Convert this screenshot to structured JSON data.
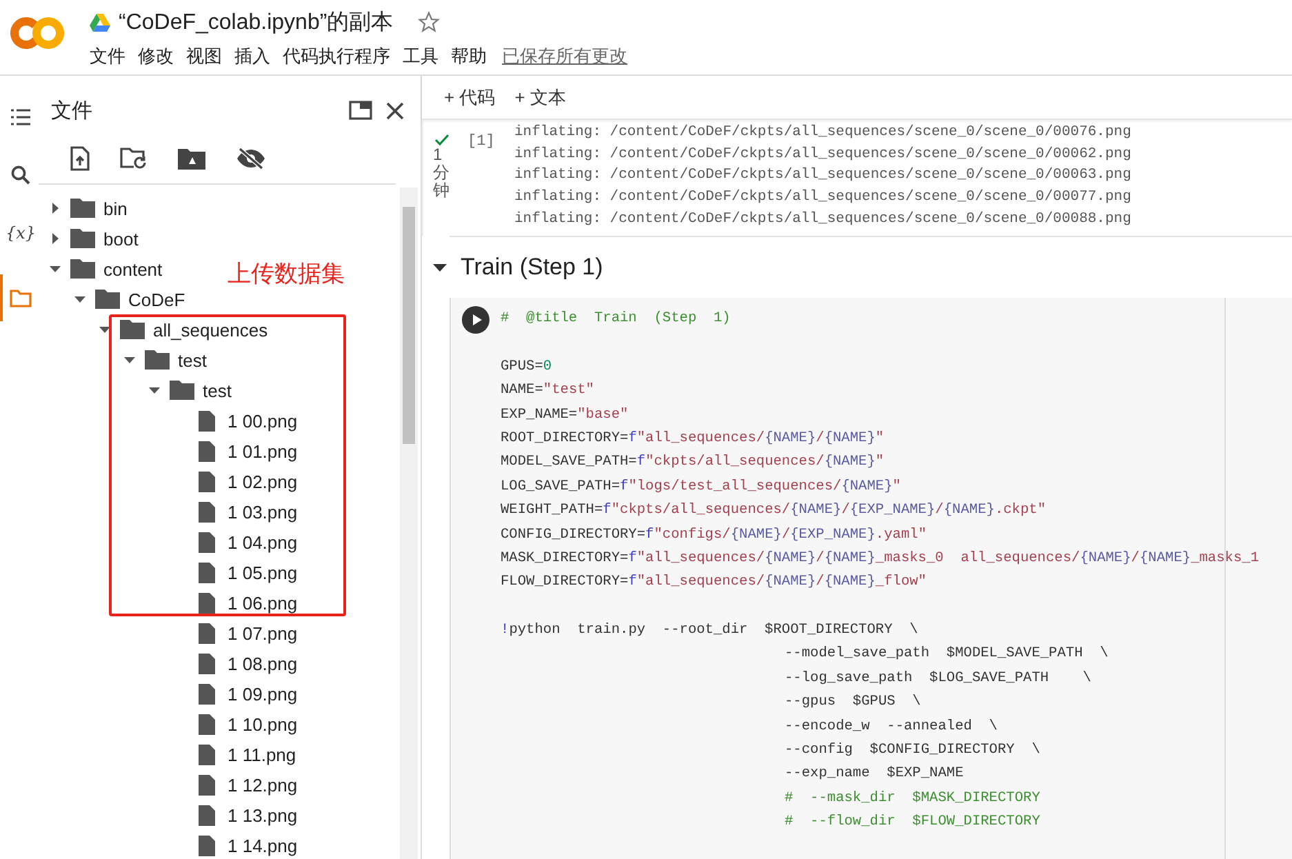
{
  "app": {
    "title": "“CoDeF_colab.ipynb”的副本",
    "starred": false,
    "menu": [
      "文件",
      "修改",
      "视图",
      "插入",
      "代码执行程序",
      "工具",
      "帮助"
    ],
    "save_status": "已保存所有更改"
  },
  "rail": [
    {
      "kind": "menu",
      "selected": false
    },
    {
      "kind": "search",
      "selected": false
    },
    {
      "kind": "variables",
      "glyph": "{x}",
      "selected": false
    },
    {
      "kind": "folder",
      "selected": true
    }
  ],
  "sidebar": {
    "title": "文件",
    "annotation": "上传数据集",
    "tree": [
      {
        "name": "bin",
        "kind": "folder",
        "expanded": false
      },
      {
        "name": "boot",
        "kind": "folder",
        "expanded": false
      },
      {
        "name": "content",
        "kind": "folder",
        "expanded": true,
        "children": [
          {
            "name": "CoDeF",
            "kind": "folder",
            "expanded": true,
            "children": [
              {
                "name": "all_sequences",
                "kind": "folder",
                "expanded": true,
                "children": [
                  {
                    "name": "test",
                    "kind": "folder",
                    "expanded": true,
                    "children": [
                      {
                        "name": "test",
                        "kind": "folder",
                        "expanded": true,
                        "children": [
                          {
                            "name": "1 00.png",
                            "kind": "file"
                          },
                          {
                            "name": "1 01.png",
                            "kind": "file"
                          },
                          {
                            "name": "1 02.png",
                            "kind": "file"
                          },
                          {
                            "name": "1 03.png",
                            "kind": "file"
                          },
                          {
                            "name": "1 04.png",
                            "kind": "file"
                          },
                          {
                            "name": "1 05.png",
                            "kind": "file"
                          },
                          {
                            "name": "1 06.png",
                            "kind": "file"
                          },
                          {
                            "name": "1 07.png",
                            "kind": "file"
                          },
                          {
                            "name": "1 08.png",
                            "kind": "file"
                          },
                          {
                            "name": "1 09.png",
                            "kind": "file"
                          },
                          {
                            "name": "1 10.png",
                            "kind": "file"
                          },
                          {
                            "name": "1 11.png",
                            "kind": "file"
                          },
                          {
                            "name": "1 12.png",
                            "kind": "file"
                          },
                          {
                            "name": "1 13.png",
                            "kind": "file"
                          },
                          {
                            "name": "1 14.png",
                            "kind": "file"
                          }
                        ]
                      }
                    ]
                  }
                ]
              }
            ]
          }
        ]
      }
    ]
  },
  "toolbar": [
    "+ 代码",
    "+ 文本"
  ],
  "output_cell": {
    "succeeded": true,
    "duration": "1分钟",
    "count": "[1]",
    "lines": [
      "inflating: /content/CoDeF/ckpts/all_sequences/scene_0/scene_0/00076.png",
      "inflating: /content/CoDeF/ckpts/all_sequences/scene_0/scene_0/00062.png",
      "inflating: /content/CoDeF/ckpts/all_sequences/scene_0/scene_0/00063.png",
      "inflating: /content/CoDeF/ckpts/all_sequences/scene_0/scene_0/00077.png",
      "inflating: /content/CoDeF/ckpts/all_sequences/scene_0/scene_0/00088.png"
    ]
  },
  "section": {
    "title": "Train (Step 1)",
    "expanded": true
  },
  "code_cell": {
    "lines": [
      {
        "tokens": [
          {
            "kind": "comment",
            "text": "#  @title  Train  (Step  1)"
          }
        ]
      },
      {
        "space_before": true,
        "tokens": [
          {
            "kind": "plain",
            "text": "GPUS="
          },
          {
            "kind": "number",
            "text": "0"
          }
        ]
      },
      {
        "tokens": [
          {
            "kind": "plain",
            "text": "NAME="
          },
          {
            "kind": "string",
            "text": "\"test\""
          }
        ]
      },
      {
        "tokens": [
          {
            "kind": "plain",
            "text": "EXP_NAME="
          },
          {
            "kind": "string",
            "text": "\"base\""
          }
        ]
      },
      {
        "tokens": [
          {
            "kind": "plain",
            "text": "ROOT_DIRECTORY="
          },
          {
            "kind": "keyword",
            "text": "f"
          },
          {
            "kind": "string",
            "text": "\"all_sequences/"
          },
          {
            "kind": "brace",
            "text": "{NAME}"
          },
          {
            "kind": "string",
            "text": "/"
          },
          {
            "kind": "brace",
            "text": "{NAME}"
          },
          {
            "kind": "string",
            "text": "\""
          }
        ]
      },
      {
        "tokens": [
          {
            "kind": "plain",
            "text": "MODEL_SAVE_PATH="
          },
          {
            "kind": "keyword",
            "text": "f"
          },
          {
            "kind": "string",
            "text": "\"ckpts/all_sequences/"
          },
          {
            "kind": "brace",
            "text": "{NAME}"
          },
          {
            "kind": "string",
            "text": "\""
          }
        ]
      },
      {
        "tokens": [
          {
            "kind": "plain",
            "text": "LOG_SAVE_PATH="
          },
          {
            "kind": "keyword",
            "text": "f"
          },
          {
            "kind": "string",
            "text": "\"logs/test_all_sequences/"
          },
          {
            "kind": "brace",
            "text": "{NAME}"
          },
          {
            "kind": "string",
            "text": "\""
          }
        ]
      },
      {
        "tokens": [
          {
            "kind": "plain",
            "text": "WEIGHT_PATH="
          },
          {
            "kind": "keyword",
            "text": "f"
          },
          {
            "kind": "string",
            "text": "\"ckpts/all_sequences/"
          },
          {
            "kind": "brace",
            "text": "{NAME}"
          },
          {
            "kind": "string",
            "text": "/"
          },
          {
            "kind": "brace",
            "text": "{EXP_NAME}"
          },
          {
            "kind": "string",
            "text": "/"
          },
          {
            "kind": "brace",
            "text": "{NAME}"
          },
          {
            "kind": "string",
            "text": ".ckpt\""
          }
        ]
      },
      {
        "tokens": [
          {
            "kind": "plain",
            "text": "CONFIG_DIRECTORY="
          },
          {
            "kind": "keyword",
            "text": "f"
          },
          {
            "kind": "string",
            "text": "\"configs/"
          },
          {
            "kind": "brace",
            "text": "{NAME}"
          },
          {
            "kind": "string",
            "text": "/"
          },
          {
            "kind": "brace",
            "text": "{EXP_NAME}"
          },
          {
            "kind": "string",
            "text": ".yaml\""
          }
        ]
      },
      {
        "tokens": [
          {
            "kind": "plain",
            "text": "MASK_DIRECTORY="
          },
          {
            "kind": "keyword",
            "text": "f"
          },
          {
            "kind": "string",
            "text": "\"all_sequences/"
          },
          {
            "kind": "brace",
            "text": "{NAME}"
          },
          {
            "kind": "string",
            "text": "/"
          },
          {
            "kind": "brace",
            "text": "{NAME}"
          },
          {
            "kind": "string",
            "text": "_masks_0  all_sequences/"
          },
          {
            "kind": "brace",
            "text": "{NAME}"
          },
          {
            "kind": "string",
            "text": "/"
          },
          {
            "kind": "brace",
            "text": "{NAME}"
          },
          {
            "kind": "string",
            "text": "_masks_1"
          }
        ]
      },
      {
        "tokens": [
          {
            "kind": "plain",
            "text": "FLOW_DIRECTORY="
          },
          {
            "kind": "keyword",
            "text": "f"
          },
          {
            "kind": "string",
            "text": "\"all_sequences/"
          },
          {
            "kind": "brace",
            "text": "{NAME}"
          },
          {
            "kind": "string",
            "text": "/"
          },
          {
            "kind": "brace",
            "text": "{NAME}"
          },
          {
            "kind": "string",
            "text": "_flow\""
          }
        ]
      },
      {
        "space_before": true,
        "tokens": [
          {
            "kind": "keyword",
            "text": "!"
          },
          {
            "kind": "plain",
            "text": "python  train.py  --root_dir  $ROOT_DIRECTORY  \\"
          }
        ]
      },
      {
        "continuation": true,
        "tokens": [
          {
            "kind": "plain",
            "text": "--model_save_path  $MODEL_SAVE_PATH  \\"
          }
        ]
      },
      {
        "continuation": true,
        "tokens": [
          {
            "kind": "plain",
            "text": "--log_save_path  $LOG_SAVE_PATH    \\"
          }
        ]
      },
      {
        "continuation": true,
        "tokens": [
          {
            "kind": "plain",
            "text": "--gpus  $GPUS  \\"
          }
        ]
      },
      {
        "continuation": true,
        "tokens": [
          {
            "kind": "plain",
            "text": "--encode_w  --annealed  \\"
          }
        ]
      },
      {
        "continuation": true,
        "tokens": [
          {
            "kind": "plain",
            "text": "--config  $CONFIG_DIRECTORY  \\"
          }
        ]
      },
      {
        "continuation": true,
        "tokens": [
          {
            "kind": "plain",
            "text": "--exp_name  $EXP_NAME"
          }
        ]
      },
      {
        "continuation": true,
        "tokens": [
          {
            "kind": "comment",
            "text": "#  --mask_dir  $MASK_DIRECTORY"
          }
        ]
      },
      {
        "continuation": true,
        "tokens": [
          {
            "kind": "comment",
            "text": "#  --flow_dir  $FLOW_DIRECTORY"
          }
        ]
      }
    ]
  }
}
